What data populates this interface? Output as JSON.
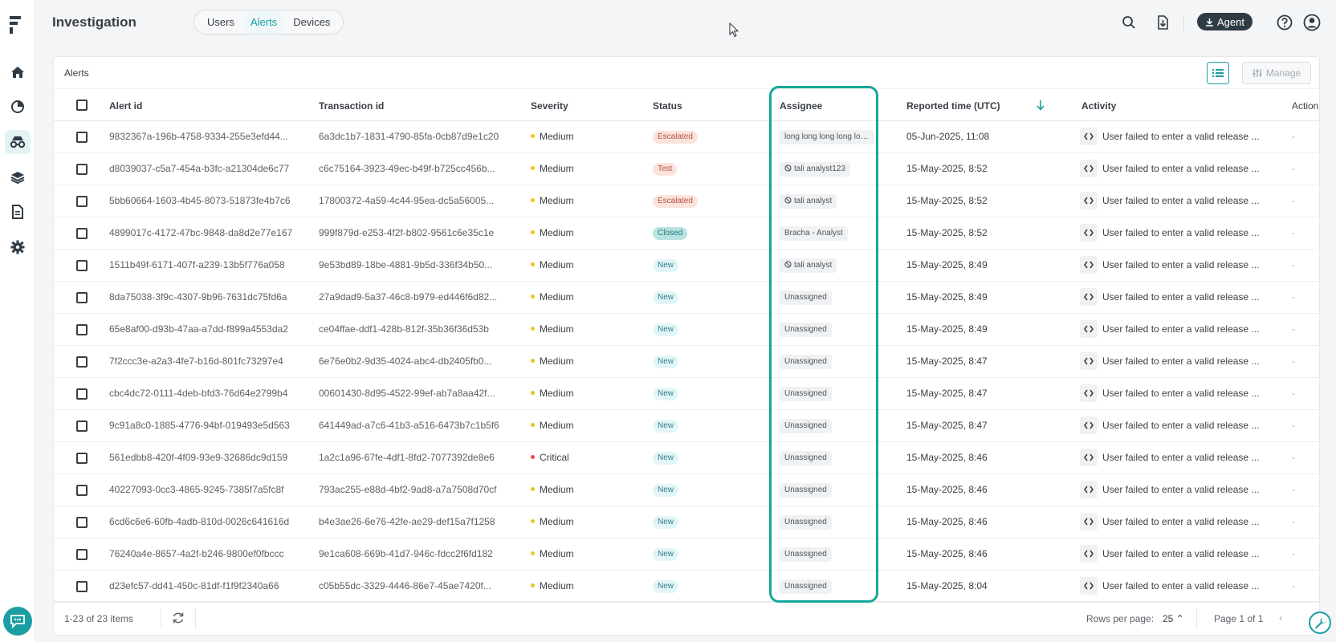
{
  "header": {
    "title": "Investigation",
    "tabs": [
      {
        "label": "Users",
        "active": false
      },
      {
        "label": "Alerts",
        "active": true
      },
      {
        "label": "Devices",
        "active": false
      }
    ],
    "agent_label": "Agent"
  },
  "panel": {
    "title": "Alerts",
    "manage_label": "Manage"
  },
  "columns": {
    "alert_id": "Alert id",
    "transaction_id": "Transaction id",
    "severity": "Severity",
    "status": "Status",
    "assignee": "Assignee",
    "reported_time": "Reported time (UTC)",
    "activity": "Activity",
    "action": "Action"
  },
  "rows": [
    {
      "alert_id": "9832367a-196b-4758-9334-255e3efd44...",
      "transaction_id": "6a3dc1b7-1831-4790-85fa-0cb87d9e1c20",
      "severity": "Medium",
      "status": "Escalated",
      "assignee": "long long long long lon...",
      "assignee_blocked": false,
      "reported_time": "05-Jun-2025, 11:08",
      "activity": "User failed to enter a valid release ...",
      "action": "-"
    },
    {
      "alert_id": "d8039037-c5a7-454a-b3fc-a21304de6c77",
      "transaction_id": "c6c75164-3923-49ec-b49f-b725cc456b...",
      "severity": "Medium",
      "status": "Test",
      "assignee": "tali analyst123",
      "assignee_blocked": true,
      "reported_time": "15-May-2025, 8:52",
      "activity": "User failed to enter a valid release ...",
      "action": "-"
    },
    {
      "alert_id": "5bb60664-1603-4b45-8073-51873fe4b7c6",
      "transaction_id": "17800372-4a59-4c44-95ea-dc5a56005...",
      "severity": "Medium",
      "status": "Escalated",
      "assignee": "tali analyst",
      "assignee_blocked": true,
      "reported_time": "15-May-2025, 8:52",
      "activity": "User failed to enter a valid release ...",
      "action": "-"
    },
    {
      "alert_id": "4899017c-4172-47bc-9848-da8d2e77e167",
      "transaction_id": "999f879d-e253-4f2f-b802-9561c6e35c1e",
      "severity": "Medium",
      "status": "Closed",
      "assignee": "Bracha - Analyst",
      "assignee_blocked": false,
      "reported_time": "15-May-2025, 8:52",
      "activity": "User failed to enter a valid release ...",
      "action": "-"
    },
    {
      "alert_id": "1511b49f-6171-407f-a239-13b5f776a058",
      "transaction_id": "9e53bd89-18be-4881-9b5d-336f34b50...",
      "severity": "Medium",
      "status": "New",
      "assignee": "tali analyst",
      "assignee_blocked": true,
      "reported_time": "15-May-2025, 8:49",
      "activity": "User failed to enter a valid release ...",
      "action": "-"
    },
    {
      "alert_id": "8da75038-3f9c-4307-9b96-7631dc75fd6a",
      "transaction_id": "27a9dad9-5a37-46c8-b979-ed446f6d82...",
      "severity": "Medium",
      "status": "New",
      "assignee": "Unassigned",
      "assignee_blocked": false,
      "reported_time": "15-May-2025, 8:49",
      "activity": "User failed to enter a valid release ...",
      "action": "-"
    },
    {
      "alert_id": "65e8af00-d93b-47aa-a7dd-f899a4553da2",
      "transaction_id": "ce04ffae-ddf1-428b-812f-35b36f36d53b",
      "severity": "Medium",
      "status": "New",
      "assignee": "Unassigned",
      "assignee_blocked": false,
      "reported_time": "15-May-2025, 8:49",
      "activity": "User failed to enter a valid release ...",
      "action": "-"
    },
    {
      "alert_id": "7f2ccc3e-a2a3-4fe7-b16d-801fc73297e4",
      "transaction_id": "6e76e0b2-9d35-4024-abc4-db2405fb0...",
      "severity": "Medium",
      "status": "New",
      "assignee": "Unassigned",
      "assignee_blocked": false,
      "reported_time": "15-May-2025, 8:47",
      "activity": "User failed to enter a valid release ...",
      "action": "-"
    },
    {
      "alert_id": "cbc4dc72-0111-4deb-bfd3-76d64e2799b4",
      "transaction_id": "00601430-8d95-4522-99ef-ab7a8aa42f...",
      "severity": "Medium",
      "status": "New",
      "assignee": "Unassigned",
      "assignee_blocked": false,
      "reported_time": "15-May-2025, 8:47",
      "activity": "User failed to enter a valid release ...",
      "action": "-"
    },
    {
      "alert_id": "9c91a8c0-1885-4776-94bf-019493e5d563",
      "transaction_id": "641449ad-a7c6-41b3-a516-6473b7c1b5f6",
      "severity": "Medium",
      "status": "New",
      "assignee": "Unassigned",
      "assignee_blocked": false,
      "reported_time": "15-May-2025, 8:47",
      "activity": "User failed to enter a valid release ...",
      "action": "-"
    },
    {
      "alert_id": "561edbb8-420f-4f09-93e9-32686dc9d159",
      "transaction_id": "1a2c1a96-67fe-4df1-8fd2-7077392de8e6",
      "severity": "Critical",
      "status": "New",
      "assignee": "Unassigned",
      "assignee_blocked": false,
      "reported_time": "15-May-2025, 8:46",
      "activity": "User failed to enter a valid release ...",
      "action": "-"
    },
    {
      "alert_id": "40227093-0cc3-4865-9245-7385f7a5fc8f",
      "transaction_id": "793ac255-e88d-4bf2-9ad8-a7a7508d70cf",
      "severity": "Medium",
      "status": "New",
      "assignee": "Unassigned",
      "assignee_blocked": false,
      "reported_time": "15-May-2025, 8:46",
      "activity": "User failed to enter a valid release ...",
      "action": "-"
    },
    {
      "alert_id": "6cd6c6e6-60fb-4adb-810d-0026c641616d",
      "transaction_id": "b4e3ae26-6e76-42fe-ae29-def15a7f1258",
      "severity": "Medium",
      "status": "New",
      "assignee": "Unassigned",
      "assignee_blocked": false,
      "reported_time": "15-May-2025, 8:46",
      "activity": "User failed to enter a valid release ...",
      "action": "-"
    },
    {
      "alert_id": "76240a4e-8657-4a2f-b246-9800ef0fbccc",
      "transaction_id": "9e1ca608-669b-41d7-946c-fdcc2f6fd182",
      "severity": "Medium",
      "status": "New",
      "assignee": "Unassigned",
      "assignee_blocked": false,
      "reported_time": "15-May-2025, 8:46",
      "activity": "User failed to enter a valid release ...",
      "action": "-"
    },
    {
      "alert_id": "d23efc57-dd41-450c-81df-f1f9f2340a66",
      "transaction_id": "c05b55dc-3329-4446-86e7-45ae7420f...",
      "severity": "Medium",
      "status": "New",
      "assignee": "Unassigned",
      "assignee_blocked": false,
      "reported_time": "15-May-2025, 8:04",
      "activity": "User failed to enter a valid release ...",
      "action": "-"
    }
  ],
  "footer": {
    "count": "1-23 of 23 items",
    "rows_per_page_label": "Rows per page:",
    "rows_per_page_value": "25",
    "page_label": "Page 1 of 1"
  },
  "colors": {
    "accent": "#1a9ea3",
    "highlight": "#16a89a",
    "severity_medium": "#f0c419",
    "severity_critical": "#e74c3c"
  }
}
